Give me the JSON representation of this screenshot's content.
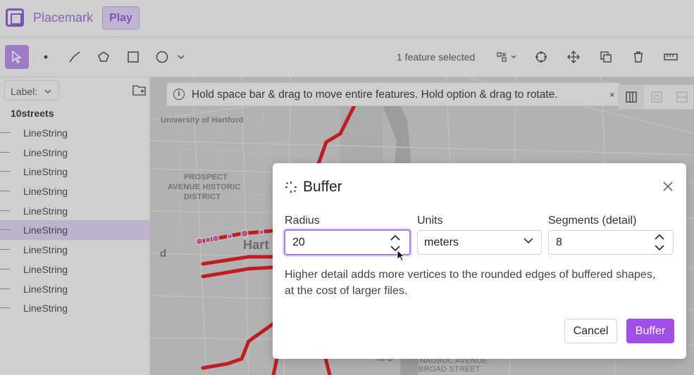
{
  "app": {
    "brand": "Placemark",
    "play_label": "Play"
  },
  "toolbar": {
    "tools": [
      "select-tool",
      "point-tool",
      "line-tool",
      "polygon-tool",
      "rectangle-tool",
      "circle-tool"
    ],
    "selection_text": "1 feature selected"
  },
  "sidebar": {
    "label_select": "Label:",
    "layer_name": "10streets",
    "features": [
      "LineString",
      "LineString",
      "LineString",
      "LineString",
      "LineString",
      "LineString",
      "LineString",
      "LineString",
      "LineString",
      "LineString"
    ],
    "selected_index": 5
  },
  "banner": {
    "text": "Hold space bar & drag to move entire features. Hold option & drag to rotate.",
    "close": "×"
  },
  "map": {
    "labels": {
      "university": "University of Hartford",
      "prospect1": "PROSPECT",
      "prospect2": "AVENUE HISTORIC",
      "prospect3": "DISTRICT",
      "hartford": "Hart",
      "d_left": "d",
      "hfd": "HFD",
      "nauboc": "NAUBUC AVENUE",
      "broad": "BROAD STREET"
    }
  },
  "dialog": {
    "title": "Buffer",
    "radius_label": "Radius",
    "radius_value": "20",
    "units_label": "Units",
    "units_value": "meters",
    "segments_label": "Segments (detail)",
    "segments_value": "8",
    "help": "Higher detail adds more vertices to the rounded edges of buffered shapes, at the cost of larger files.",
    "cancel": "Cancel",
    "submit": "Buffer"
  },
  "colors": {
    "accent": "#a24ee8",
    "selected_row": "#d6c6ea",
    "road": "#d40000"
  }
}
